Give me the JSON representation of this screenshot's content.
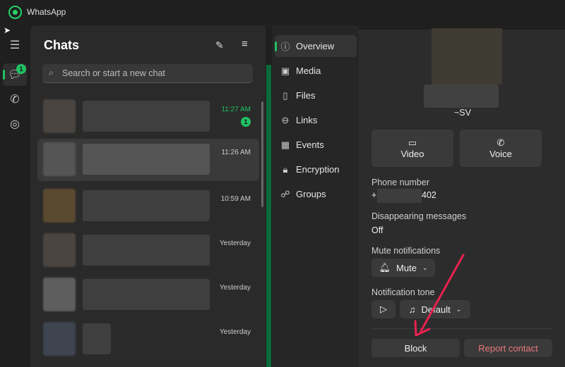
{
  "app": {
    "title": "WhatsApp"
  },
  "rail": {
    "chats_badge": "1"
  },
  "chats": {
    "title": "Chats",
    "search_placeholder": "Search or start a new chat",
    "rows": [
      {
        "time": "11:27 AM",
        "unread": "1"
      },
      {
        "time": "11:26 AM"
      },
      {
        "time": "10:59 AM"
      },
      {
        "time": "Yesterday"
      },
      {
        "time": "Yesterday"
      },
      {
        "time": "Yesterday"
      }
    ]
  },
  "nav": {
    "items": [
      {
        "label": "Overview"
      },
      {
        "label": "Media"
      },
      {
        "label": "Files"
      },
      {
        "label": "Links"
      },
      {
        "label": "Events"
      },
      {
        "label": "Encryption"
      },
      {
        "label": "Groups"
      }
    ]
  },
  "contact": {
    "name": "~SV",
    "video": "Video",
    "voice": "Voice",
    "phone_label": "Phone number",
    "phone_prefix": "+",
    "phone_suffix": "402",
    "disappearing_label": "Disappearing messages",
    "disappearing_value": "Off",
    "mute_label": "Mute notifications",
    "mute_button": "Mute",
    "tone_label": "Notification tone",
    "tone_value": "Default",
    "block": "Block",
    "report": "Report contact"
  },
  "colors": {
    "accent": "#21c063",
    "danger": "#e8787b",
    "arrow": "#e8224f"
  }
}
